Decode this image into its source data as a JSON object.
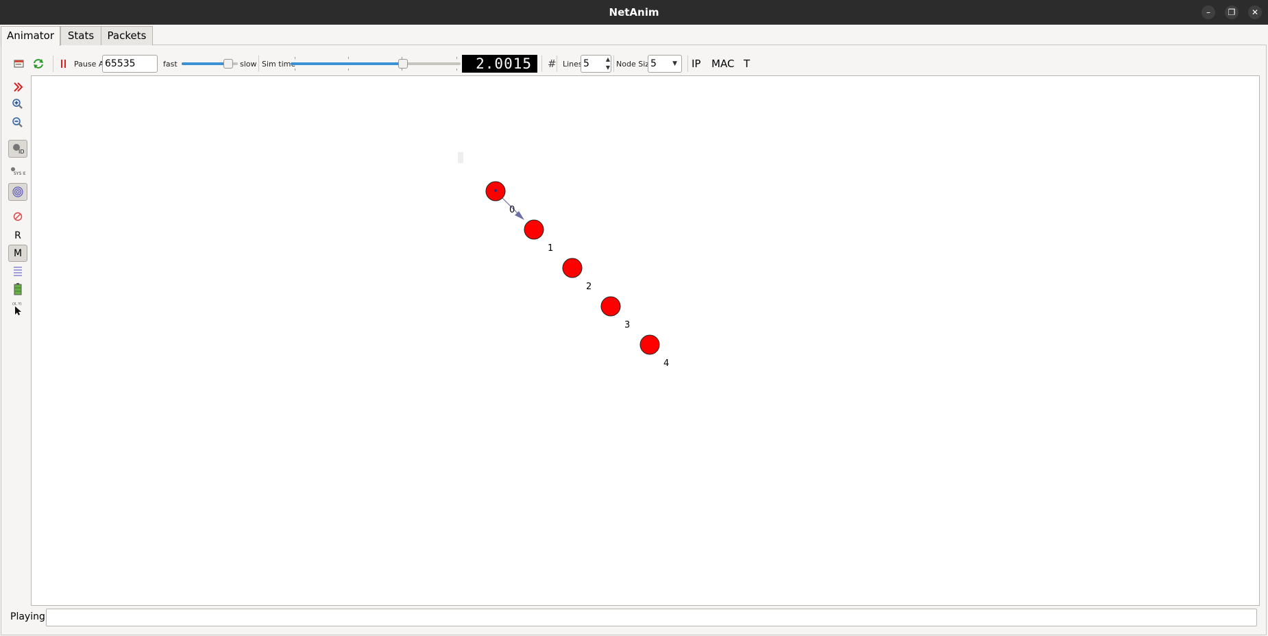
{
  "window": {
    "title": "NetAnim",
    "minimize_glyph": "–",
    "maximize_glyph": "❐",
    "close_glyph": "✕"
  },
  "tabs": [
    {
      "label": "Animator",
      "active": true
    },
    {
      "label": "Stats",
      "active": false
    },
    {
      "label": "Packets",
      "active": false
    }
  ],
  "toolbar": {
    "open_icon": "open-file-icon",
    "reload_icon": "reload-icon",
    "pause_icon": "pause-icon",
    "pause_at_label": "Pause At",
    "pause_at_value": "65535",
    "fast_label": "fast",
    "slow_label": "slow",
    "speed_value": 0.83,
    "sim_time_label": "Sim time",
    "sim_time_position": 0.66,
    "sim_clock": "2.0015",
    "grid_icon": "grid-hash-icon",
    "grid_glyph": "#",
    "lines_label": "Lines",
    "lines_value": "5",
    "node_size_label": "Node Size",
    "node_size_value": "5",
    "ip_label": "IP",
    "mac_label": "MAC",
    "t_label": "T"
  },
  "left_tools": [
    {
      "name": "fast-forward-icon",
      "pressed": false
    },
    {
      "name": "zoom-in-icon",
      "pressed": false
    },
    {
      "name": "zoom-out-icon",
      "pressed": false
    },
    {
      "name": "show-node-id-icon",
      "pressed": true
    },
    {
      "name": "show-node-sysid-icon",
      "pressed": false
    },
    {
      "name": "wireless-circles-icon",
      "pressed": true
    },
    {
      "name": "no-packets-icon",
      "pressed": false
    },
    {
      "name": "routing-r-label",
      "label": "R",
      "pressed": false
    },
    {
      "name": "mobility-m-label",
      "label": "M",
      "pressed": true
    },
    {
      "name": "batch-lines-icon",
      "pressed": false
    },
    {
      "name": "battery-icon",
      "pressed": false
    },
    {
      "name": "mouse-position-icon",
      "label": "(X, Y)",
      "pressed": false
    }
  ],
  "nodes": [
    {
      "id": "0",
      "color": "#ff0000"
    },
    {
      "id": "1",
      "color": "#ff0000"
    },
    {
      "id": "2",
      "color": "#ff0000"
    },
    {
      "id": "3",
      "color": "#ff0000"
    },
    {
      "id": "4",
      "color": "#ff0000"
    }
  ],
  "packet": {
    "from": "0",
    "to": "1",
    "color": "#6f6fa8"
  },
  "status": {
    "label": "Playing",
    "value": ""
  }
}
